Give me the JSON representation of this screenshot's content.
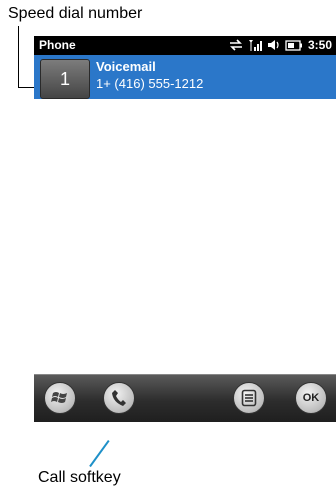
{
  "annotations": {
    "speed_dial_label": "Speed dial number",
    "call_softkey_label": "Call softkey"
  },
  "status_bar": {
    "title": "Phone",
    "time": "3:50"
  },
  "speed_dial": {
    "number": "1",
    "name": "Voicemail",
    "phone": "1+ (416) 555-1212"
  },
  "softkeys": {
    "ok_label": "OK"
  },
  "colors": {
    "selection_blue": "#2b77c9",
    "status_bar": "#000000",
    "callout_line_blue": "#1e90c8"
  },
  "icons": [
    "windows-start-icon",
    "phone-handset-icon",
    "menu-list-icon",
    "ok-icon",
    "sync-arrows-icon",
    "signal-icon",
    "speaker-icon",
    "battery-icon"
  ]
}
